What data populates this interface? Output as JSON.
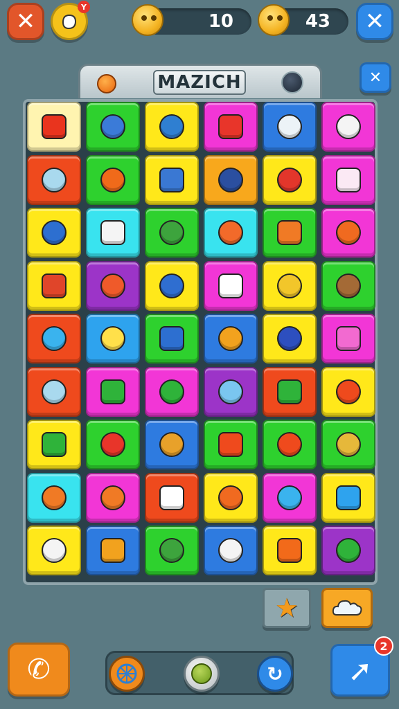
{
  "hud": {
    "coins_left": "10",
    "coins_right": "43",
    "notice_badge": "Y"
  },
  "board": {
    "title": "MAZICH",
    "rows": [
      [
        {
          "color": "#fff4b0",
          "icon": "sun-icon",
          "fill": "#e9341e"
        },
        {
          "color": "#2ed12e",
          "icon": "pencil-icon",
          "fill": "#3b7bd8"
        },
        {
          "color": "#ffe81a",
          "icon": "fish-icon",
          "fill": "#2f7fd1"
        },
        {
          "color": "#f236d6",
          "icon": "flag-icon",
          "fill": "#e8352a"
        },
        {
          "color": "#2e7be0",
          "icon": "ghost-icon",
          "fill": "#ecf3f7"
        },
        {
          "color": "#f236d6",
          "icon": "calendar-icon",
          "fill": "#f4f4f4"
        }
      ],
      [
        {
          "color": "#ef4a1d",
          "icon": "robot-face-icon",
          "fill": "#a9d9ee"
        },
        {
          "color": "#2ed12e",
          "icon": "tomato-icon",
          "fill": "#f06a1a"
        },
        {
          "color": "#ffe81a",
          "icon": "bowl-icon",
          "fill": "#3a78d3"
        },
        {
          "color": "#f8a81c",
          "icon": "monitor-icon",
          "fill": "#2b4fa0"
        },
        {
          "color": "#ffe81a",
          "icon": "spiral-icon",
          "fill": "#e3362b"
        },
        {
          "color": "#f236d6",
          "icon": "flower-face-icon",
          "fill": "#fbe9f4"
        }
      ],
      [
        {
          "color": "#ffe81a",
          "icon": "key-icon",
          "fill": "#2d6fd0"
        },
        {
          "color": "#39e3ef",
          "icon": "rice-bowl-icon",
          "fill": "#f4f4f4"
        },
        {
          "color": "#2ed12e",
          "icon": "house-icon",
          "fill": "#3da43d"
        },
        {
          "color": "#39e3ef",
          "icon": "onion-face-icon",
          "fill": "#f26a2a"
        },
        {
          "color": "#2ed12e",
          "icon": "carrot-icon",
          "fill": "#f07a25"
        },
        {
          "color": "#f236d6",
          "icon": "pen-icon",
          "fill": "#f06a20"
        }
      ],
      [
        {
          "color": "#ffe81a",
          "icon": "envelope-icon",
          "fill": "#e0452a"
        },
        {
          "color": "#9c34c8",
          "icon": "carrot-icon",
          "fill": "#ef5a2a"
        },
        {
          "color": "#ffe81a",
          "icon": "chart-icon",
          "fill": "#2f6ed0"
        },
        {
          "color": "#f236d6",
          "icon": "ice-cream-icon",
          "fill": "#ffffff"
        },
        {
          "color": "#ffe81a",
          "icon": "laptop-icon",
          "fill": "#f2c62a"
        },
        {
          "color": "#2ed12e",
          "icon": "bag-icon",
          "fill": "#a46a36"
        }
      ],
      [
        {
          "color": "#ef4a1d",
          "icon": "popsicle-icon",
          "fill": "#3ab3ee"
        },
        {
          "color": "#2ea3ee",
          "icon": "cheese-icon",
          "fill": "#ffe04a"
        },
        {
          "color": "#2ed12e",
          "icon": "gear-face-icon",
          "fill": "#2d6fd0"
        },
        {
          "color": "#2e7be0",
          "icon": "flower-icon",
          "fill": "#f2a21e"
        },
        {
          "color": "#ffe81a",
          "icon": "flower-icon",
          "fill": "#2d4fbf"
        },
        {
          "color": "#f236d6",
          "icon": "cloud-face-icon",
          "fill": "#f26ad0"
        }
      ],
      [
        {
          "color": "#ef4a1d",
          "icon": "radio-icon",
          "fill": "#a9d9ee"
        },
        {
          "color": "#f236d6",
          "icon": "cactus-icon",
          "fill": "#2fb33a"
        },
        {
          "color": "#f236d6",
          "icon": "ball-icon",
          "fill": "#2fb33a"
        },
        {
          "color": "#9c34c8",
          "icon": "syringe-icon",
          "fill": "#7ac6f0"
        },
        {
          "color": "#ef4a1d",
          "icon": "camera-icon",
          "fill": "#2fb33a"
        },
        {
          "color": "#ffe81a",
          "icon": "leaf-icon",
          "fill": "#ef4a1d"
        }
      ],
      [
        {
          "color": "#ffe81a",
          "icon": "bell-icon",
          "fill": "#2fb33a"
        },
        {
          "color": "#2ed12e",
          "icon": "crab-icon",
          "fill": "#e8352a"
        },
        {
          "color": "#2e7be0",
          "icon": "wheel-icon",
          "fill": "#e8a12a"
        },
        {
          "color": "#2ed12e",
          "icon": "ball-icon",
          "fill": "#ef4a1d"
        },
        {
          "color": "#2ed12e",
          "icon": "gem-icon",
          "fill": "#ef4a1d"
        },
        {
          "color": "#2ed12e",
          "icon": "broom-icon",
          "fill": "#e6b83a"
        }
      ],
      [
        {
          "color": "#39e3ef",
          "icon": "rocket-icon",
          "fill": "#f07a25"
        },
        {
          "color": "#f236d6",
          "icon": "crayon-icon",
          "fill": "#f07a25"
        },
        {
          "color": "#ef4a1d",
          "icon": "face-icon",
          "fill": "#ffffff"
        },
        {
          "color": "#ffe81a",
          "icon": "crayon-icon",
          "fill": "#f06a20"
        },
        {
          "color": "#f236d6",
          "icon": "leaf-icon",
          "fill": "#3ab3ee"
        },
        {
          "color": "#ffe81a",
          "icon": "fish-icon",
          "fill": "#2ea3ee"
        }
      ],
      [
        {
          "color": "#ffe81a",
          "icon": "ghost-face-icon",
          "fill": "#f4f4f4"
        },
        {
          "color": "#2e7be0",
          "icon": "pudding-icon",
          "fill": "#f2a21e"
        },
        {
          "color": "#2ed12e",
          "icon": "board-icon",
          "fill": "#3da43d"
        },
        {
          "color": "#2e7be0",
          "icon": "computer-icon",
          "fill": "#f4f4f4"
        },
        {
          "color": "#ffe81a",
          "icon": "spiky-face-icon",
          "fill": "#f26a1a"
        },
        {
          "color": "#9c34c8",
          "icon": "magnifier-icon",
          "fill": "#2fb33a"
        }
      ]
    ]
  },
  "colors": {
    "close_left": "#e2562a",
    "close_right": "#2f8ae8",
    "phone": "#f08a1c",
    "share": "#2f8ae8",
    "share_badge": "#e8352a"
  },
  "share_badge_count": "2"
}
